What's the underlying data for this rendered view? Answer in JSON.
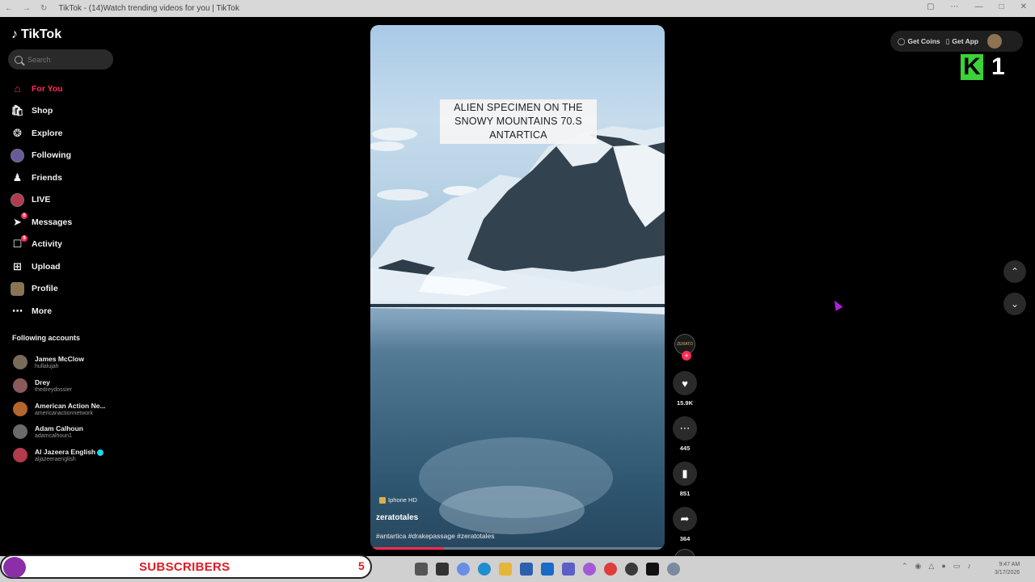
{
  "browser": {
    "tab_title": "TikTok - (14)Watch trending videos for you | TikTok",
    "controls": [
      "←",
      "→",
      "↻"
    ]
  },
  "sidebar": {
    "logo": "TikTok",
    "search_placeholder": "Search",
    "nav": [
      {
        "label": "For You",
        "icon": "home-icon"
      },
      {
        "label": "Shop",
        "icon": "shopping-bag-icon"
      },
      {
        "label": "Explore",
        "icon": "compass-icon"
      },
      {
        "label": "Following",
        "icon": "following-avatar-icon"
      },
      {
        "label": "Friends",
        "icon": "friends-icon"
      },
      {
        "label": "LIVE",
        "icon": "live-icon"
      },
      {
        "label": "Messages",
        "icon": "paper-plane-icon",
        "badge": "6"
      },
      {
        "label": "Activity",
        "icon": "activity-icon",
        "badge": "9"
      },
      {
        "label": "Upload",
        "icon": "plus-square-icon"
      },
      {
        "label": "Profile",
        "icon": "profile-avatar-icon"
      },
      {
        "label": "More",
        "icon": "more-dots-icon"
      }
    ],
    "following_title": "Following accounts",
    "following": [
      {
        "name": "James McClow",
        "handle": "hullalujah"
      },
      {
        "name": "Drey",
        "handle": "thedreydossier"
      },
      {
        "name": "American Action Ne...",
        "handle": "americanactionnetwork"
      },
      {
        "name": "Adam Calhoun",
        "handle": "adamcalhoun1"
      },
      {
        "name": "Al Jazeera English",
        "handle": "aljazeeraenglish"
      }
    ]
  },
  "video": {
    "caption": "ALIEN SPECIMEN ON THE SNOWY MOUNTAINS 70.S ANTARTICA",
    "effect": "Iphone HD",
    "author": "zeratotales",
    "hashtags": "#antartica #drakepassage #zeratotales",
    "progress": 0.25
  },
  "actions": {
    "creator_label": "ZERATO",
    "likes": "15.9K",
    "comments": "445",
    "saves": "851",
    "shares": "364"
  },
  "topbar": {
    "get_coins": "Get Coins",
    "get_app": "Get App"
  },
  "overlay": {
    "k_letter": "K",
    "k_number": "1",
    "subscribers_label": "SUBSCRIBERS",
    "subscribers_count": "5"
  },
  "taskbar": {
    "time": "9:47 AM",
    "date": "3/17/2026"
  },
  "colors": {
    "accent": "#fe2c55",
    "k_green": "#3ad338",
    "subscribers_red": "#e01b24"
  }
}
